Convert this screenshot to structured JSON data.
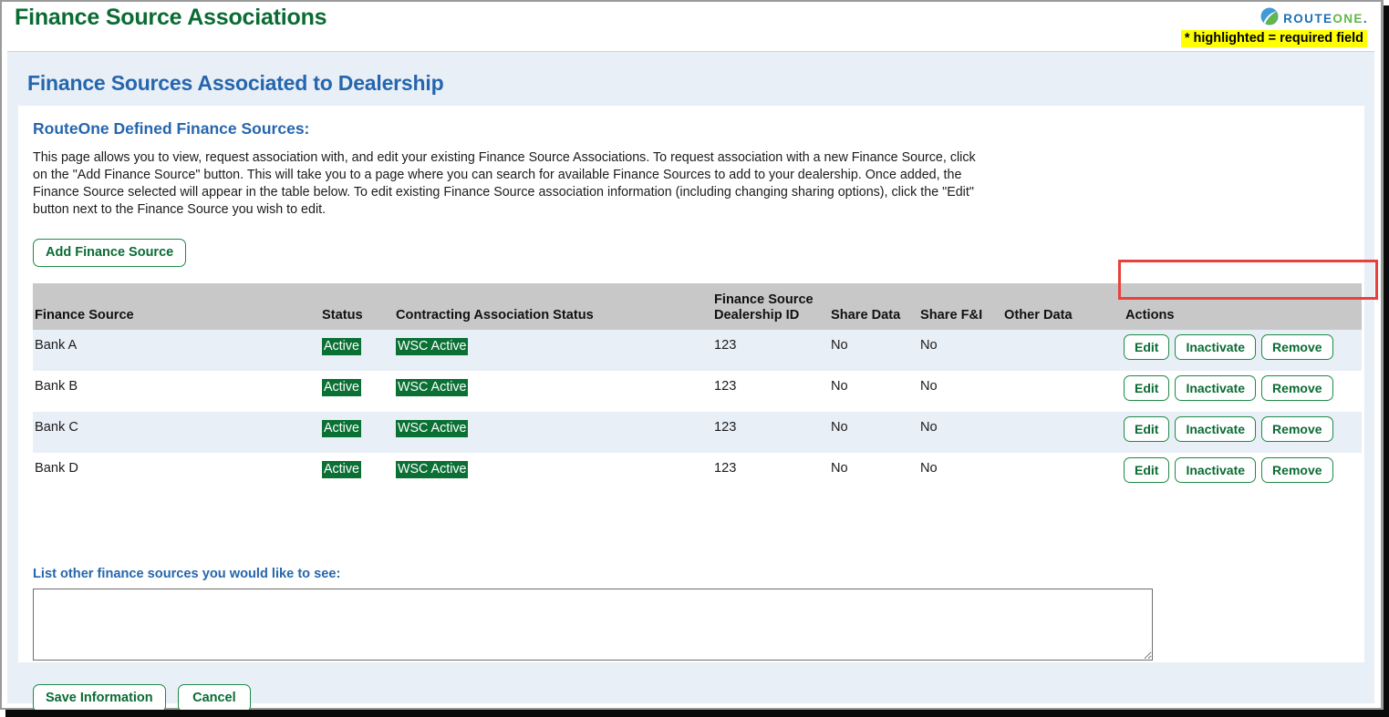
{
  "window": {
    "page_title": "Finance Source Associations",
    "required_note": "* highlighted = required field",
    "brand": {
      "name_part1": "ROUTE",
      "name_part2": "ONE",
      "name_suffix": ".",
      "blue": "#1a6fb5",
      "green": "#63b648"
    }
  },
  "section": {
    "heading": "Finance Sources Associated to Dealership",
    "subheading": "RouteOne Defined Finance Sources:",
    "intro_paragraph": "This page allows you to view, request association with, and edit your existing Finance Source Associations. To request association with a new Finance Source, click on the \"Add Finance Source\" button. This will take you to a page where you can search for available Finance Sources to add to your dealership. Once added, the Finance Source selected will appear in the table below. To edit existing Finance Source association information (including changing sharing options), click the \"Edit\" button next to the Finance Source you wish to edit.",
    "add_button_label": "Add Finance Source"
  },
  "table": {
    "columns": [
      "Finance Source",
      "Status",
      "Contracting Association Status",
      "Finance Source\nDealership ID",
      "Share Data",
      "Share F&I",
      "Other Data",
      "Actions"
    ],
    "column_finance_source": "Finance Source",
    "column_status": "Status",
    "column_contracting_status": "Contracting Association Status",
    "column_fs_dealership_id_line1": "Finance Source",
    "column_fs_dealership_id_line2": "Dealership ID",
    "column_share_data": "Share Data",
    "column_share_fi": "Share F&I",
    "column_other_data": "Other Data",
    "column_actions": "Actions",
    "action_labels": {
      "edit": "Edit",
      "inactivate": "Inactivate",
      "remove": "Remove"
    },
    "rows": [
      {
        "finance_source": "Bank A",
        "status": "Active",
        "contracting_status": "WSC Active",
        "fs_dealership_id": "123",
        "share_data": "No",
        "share_fi": "No",
        "other_data": ""
      },
      {
        "finance_source": "Bank B",
        "status": "Active",
        "contracting_status": "WSC Active",
        "fs_dealership_id": "123",
        "share_data": "No",
        "share_fi": "No",
        "other_data": ""
      },
      {
        "finance_source": "Bank C",
        "status": "Active",
        "contracting_status": "WSC Active",
        "fs_dealership_id": "123",
        "share_data": "No",
        "share_fi": "No",
        "other_data": ""
      },
      {
        "finance_source": "Bank D",
        "status": "Active",
        "contracting_status": "WSC Active",
        "fs_dealership_id": "123",
        "share_data": "No",
        "share_fi": "No",
        "other_data": ""
      }
    ]
  },
  "form": {
    "other_sources_label": "List other finance sources you would like to see:",
    "other_sources_value": "",
    "other_sources_placeholder": "",
    "save_label": "Save Information",
    "cancel_label": "Cancel"
  },
  "colors": {
    "green_accent": "#0a6b33",
    "blue_heading": "#2566ad",
    "status_green_bg": "#0a7034",
    "highlight_yellow": "#ffff00",
    "highlight_red": "#e8413c",
    "panel_blue": "#e9eff7",
    "table_header_gray": "#c8c8c8"
  }
}
